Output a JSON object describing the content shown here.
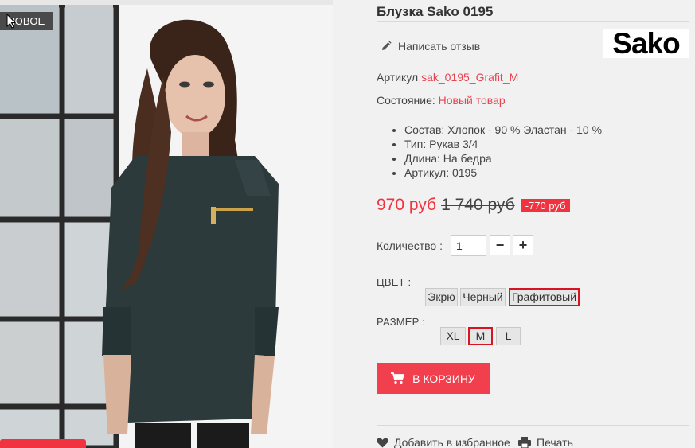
{
  "product": {
    "title": "Блузка Sako 0195",
    "new_badge": "НОВОЕ",
    "brand": "Sako",
    "review_link": "Написать отзыв",
    "sku_label": "Артикул",
    "sku_value": "sak_0195_Grafit_M",
    "condition_label": "Состояние:",
    "condition_value": "Новый товар",
    "features": [
      "Состав: Хлопок - 90 % Эластан - 10 %",
      "Тип: Рукав 3/4",
      "Длина: На бедра",
      "Артикул: 0195"
    ]
  },
  "price": {
    "current": "970 руб",
    "old": "1 740 руб",
    "discount": "-770 руб"
  },
  "quantity": {
    "label": "Количество :",
    "value": "1",
    "minus": "−",
    "plus": "+"
  },
  "color": {
    "label": "ЦВЕТ :",
    "options": [
      "Экрю",
      "Черный",
      "Графитовый"
    ],
    "selected": "Графитовый"
  },
  "size": {
    "label": "РАЗМЕР :",
    "options": [
      "XL",
      "M",
      "L"
    ],
    "selected": "M"
  },
  "actions": {
    "add_to_cart": "В КОРЗИНУ",
    "wishlist": "Добавить в избранное",
    "print": "Печать"
  },
  "icons": {
    "review": "pencil-icon",
    "cart": "cart-icon",
    "wishlist": "heart-icon",
    "print": "printer-icon"
  },
  "colors": {
    "accent": "#f13340",
    "background": "#f1f1f1",
    "selected_border": "#d71522"
  }
}
